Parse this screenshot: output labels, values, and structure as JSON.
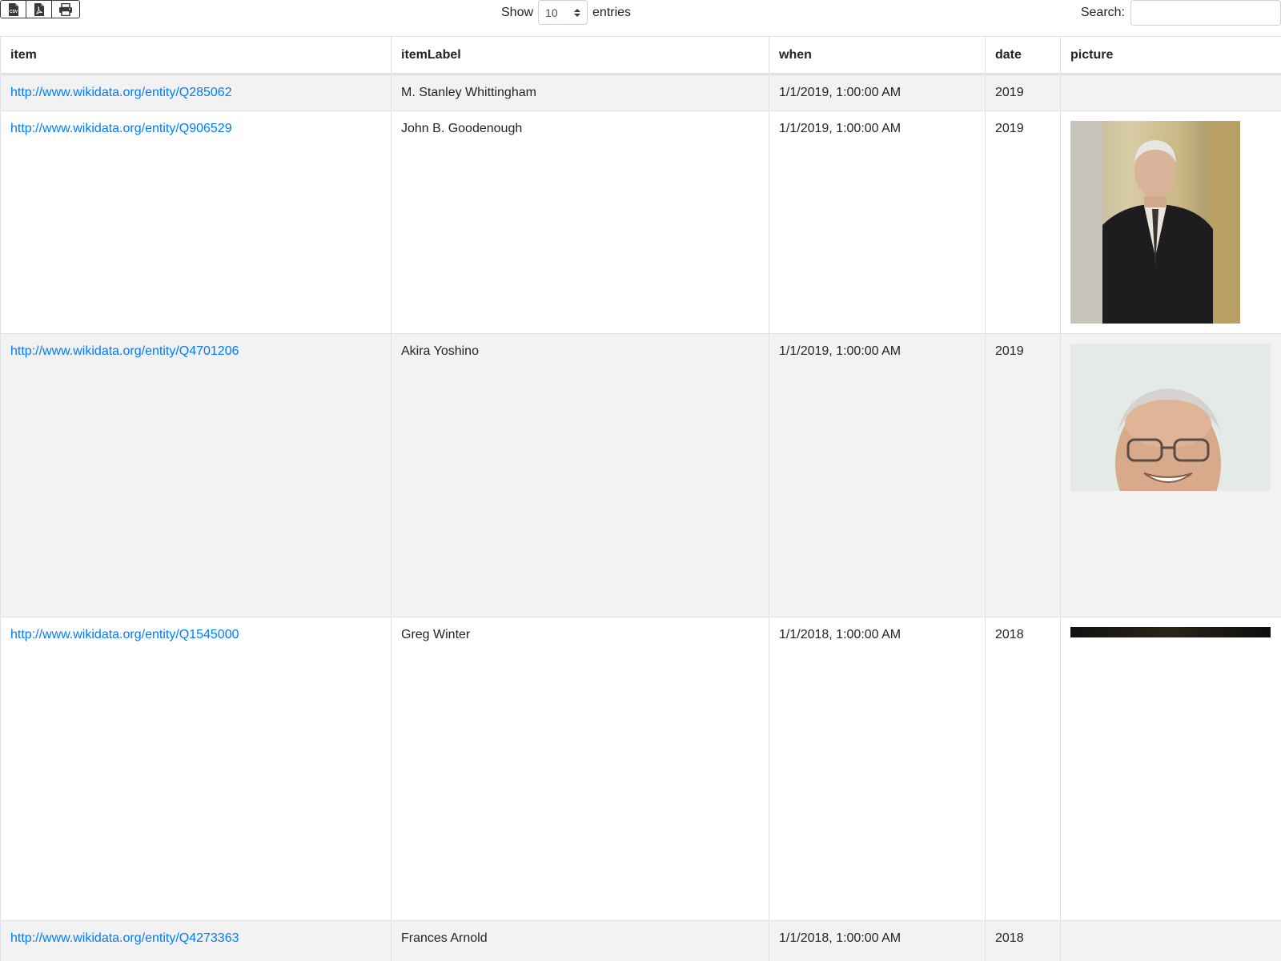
{
  "toolbar": {
    "export_buttons": [
      {
        "name": "csv-export-button",
        "icon": "csv-file-icon",
        "glyph": "CSV"
      },
      {
        "name": "pdf-export-button",
        "icon": "pdf-file-icon"
      },
      {
        "name": "print-button",
        "icon": "printer-icon"
      }
    ]
  },
  "length_menu": {
    "prefix": "Show",
    "value": "10",
    "suffix": "entries"
  },
  "search": {
    "label": "Search:",
    "value": "",
    "placeholder": ""
  },
  "table": {
    "headers": [
      "item",
      "itemLabel",
      "when",
      "date",
      "picture"
    ],
    "rows": [
      {
        "item": "http://www.wikidata.org/entity/Q285062",
        "itemLabel": "M. Stanley Whittingham",
        "when": "1/1/2019, 1:00:00 AM",
        "date": "2019",
        "picture": "none"
      },
      {
        "item": "http://www.wikidata.org/entity/Q906529",
        "itemLabel": "John B. Goodenough",
        "when": "1/1/2019, 1:00:00 AM",
        "date": "2019",
        "picture": "portrait"
      },
      {
        "item": "http://www.wikidata.org/entity/Q4701206",
        "itemLabel": "Akira Yoshino",
        "when": "1/1/2019, 1:00:00 AM",
        "date": "2019",
        "picture": "portrait"
      },
      {
        "item": "http://www.wikidata.org/entity/Q1545000",
        "itemLabel": "Greg Winter",
        "when": "1/1/2018, 1:00:00 AM",
        "date": "2018",
        "picture": "strip"
      },
      {
        "item": "http://www.wikidata.org/entity/Q4273363",
        "itemLabel": "Frances Arnold",
        "when": "1/1/2018, 1:00:00 AM",
        "date": "2018",
        "picture": "none"
      }
    ]
  },
  "colors": {
    "link": "#007bff",
    "stripe": "#f2f2f2",
    "border": "#dee2e6",
    "text": "#212529"
  }
}
